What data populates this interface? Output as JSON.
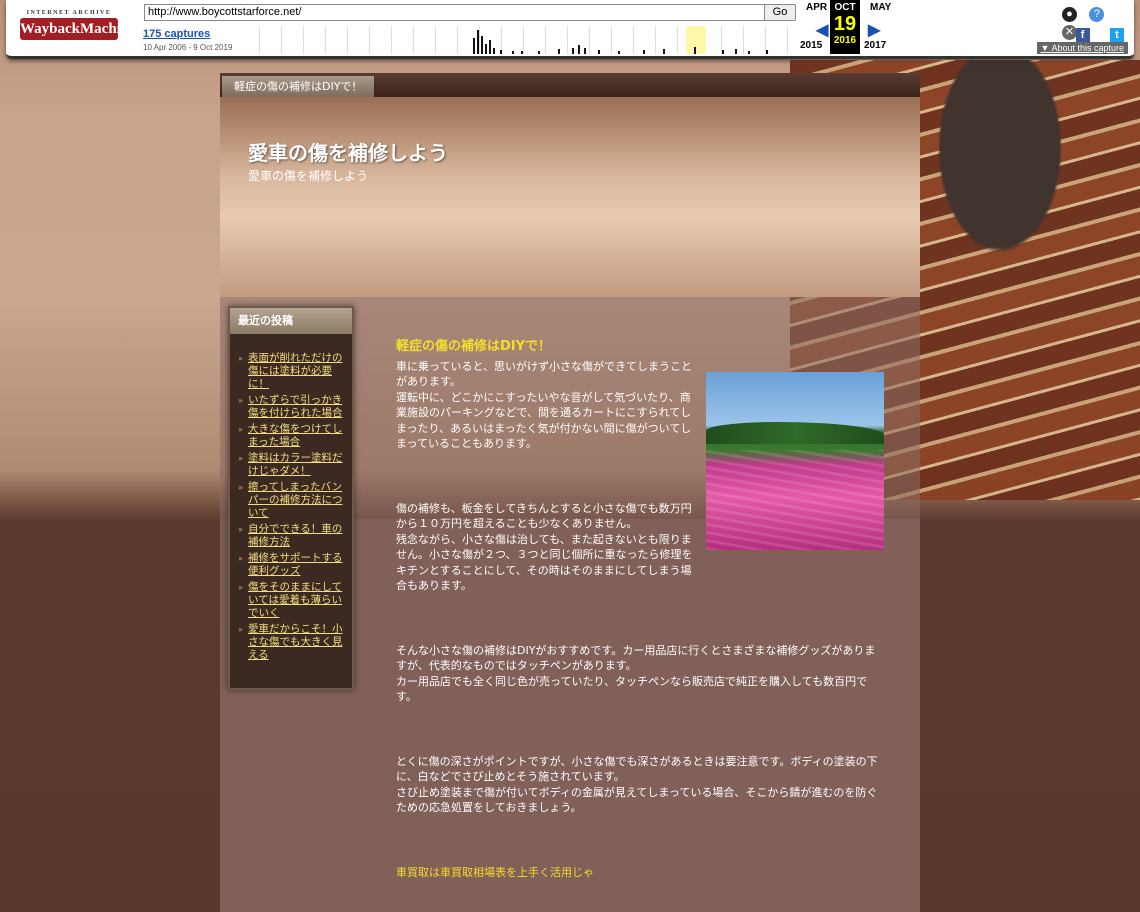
{
  "wayback": {
    "logo_top": "INTERNET ARCHIVE",
    "logo_bottom": "WaybackMachine",
    "url": "http://www.boycottstarforce.net/",
    "go_label": "Go",
    "captures": "175 captures",
    "date_range": "10 Apr 2006 - 9 Oct 2019",
    "prev_month": "APR",
    "cur_month": "OCT",
    "next_month": "MAY",
    "day": "19",
    "prev_year": "2015",
    "cur_year": "2016",
    "next_year": "2017",
    "about": "About this capture",
    "icons": [
      "user-icon",
      "help-icon",
      "close-icon",
      "facebook-icon",
      "twitter-icon"
    ]
  },
  "site": {
    "top_tab": "軽症の傷の補修はDIYで！",
    "title": "愛車の傷を補修しよう",
    "subtitle": "愛車の傷を補修しよう"
  },
  "sidebar": {
    "title": "最近の投稿",
    "items": [
      "表面が削れただけの傷には塗料が必要に！",
      "いたずらで引っかき傷を付けられた場合",
      "大きな傷をつけてしまった場合",
      "塗料はカラー塗料だけじゃダメ！",
      "擦ってしまったバンパーの補修方法について",
      "自分でできる！車の補修方法",
      "補修をサポートする便利グッズ",
      "傷をそのままにしていては愛着も薄らいでいく",
      "愛車だからこそ！小さな傷でも大きく見える"
    ]
  },
  "article": {
    "title": "軽症の傷の補修はDIYで！",
    "p1": "車に乗っていると、思いがけず小さな傷ができてしまうことがあります。\n運転中に、どこかにこすったいやな音がして気づいたり、商業施設のパーキングなどで、間を通るカートにこすられてしまったり、あるいはまったく気が付かない間に傷がついてしまっていることもあります。",
    "p2": "傷の補修も、板金をしてきちんとすると小さな傷でも数万円から１０万円を超えることも少なくありません。\n残念ながら、小さな傷は治しても、また起きないとも限りません。小さな傷が２つ、３つと同じ個所に重なったら修理をキチンとすることにして、その時はそのままにしてしまう場合もあります。",
    "p3": "そんな小さな傷の補修はDIYがおすすめです。カー用品店に行くとさまざまな補修グッズがありますが、代表的なものではタッチペンがあります。\nカー用品店でも全く同じ色が売っていたり、タッチペンなら販売店で純正を購入しても数百円です。",
    "p4": "とくに傷の深さがポイントですが、小さな傷でも深さがあるときは要注意です。ボディの塗装の下に、白などでさび止めとそう施されています。\nさび止め塗装まで傷が付いてボディの金属が見えてしまっている場合、そこから錆が進むのを防ぐための応急処置をしておきましょう。",
    "link": "車買取は車買取相場表を上手く活用じゃ"
  }
}
